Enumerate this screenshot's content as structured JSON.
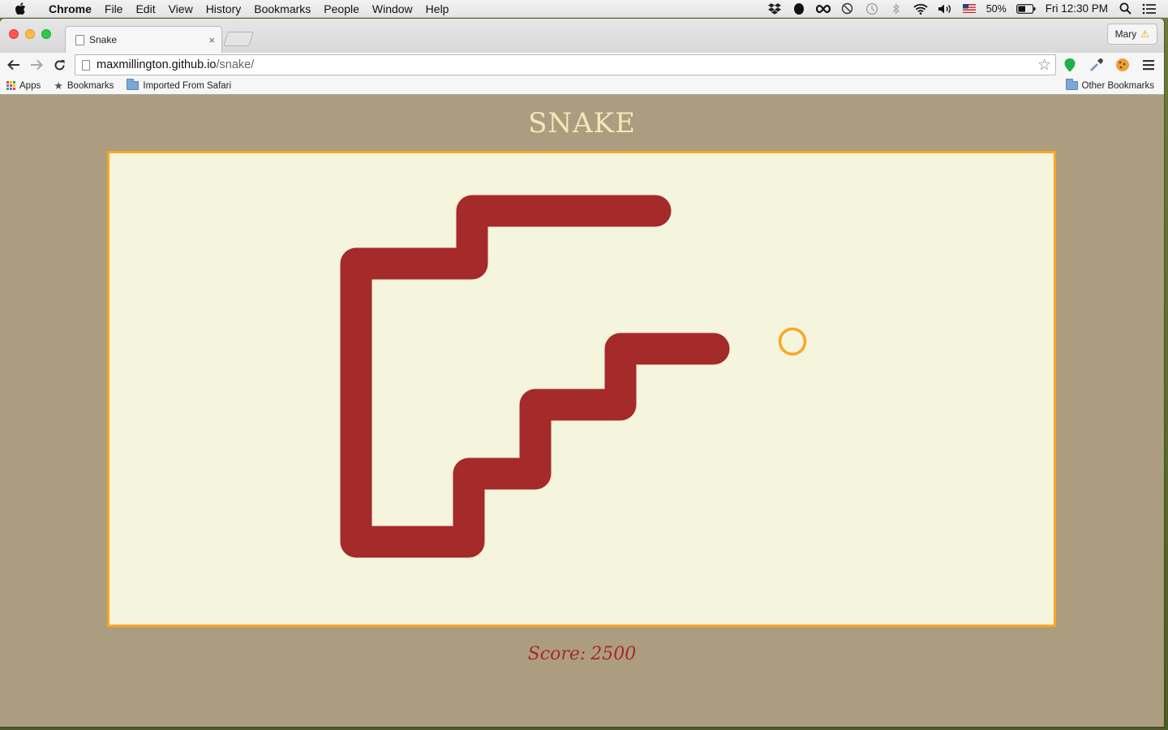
{
  "menubar": {
    "items": [
      "Chrome",
      "File",
      "Edit",
      "View",
      "History",
      "Bookmarks",
      "People",
      "Window",
      "Help"
    ],
    "battery": "50%",
    "clock": "Fri 12:30 PM"
  },
  "browser": {
    "tab_title": "Snake",
    "tab_close": "×",
    "profile_name": "Mary",
    "url_host": "maxmillington.github.io",
    "url_path": "/snake/",
    "bookmarks": [
      "Apps",
      "Bookmarks",
      "Imported From Safari"
    ],
    "other_bookmarks": "Other Bookmarks"
  },
  "game": {
    "title": "SNAKE",
    "score_label": "Score:",
    "score_value": "2500",
    "snake_color": "#a52a2a",
    "food_color": "#f7a823",
    "board_color": "#f5f4dc",
    "page_color": "#ad9d80"
  }
}
